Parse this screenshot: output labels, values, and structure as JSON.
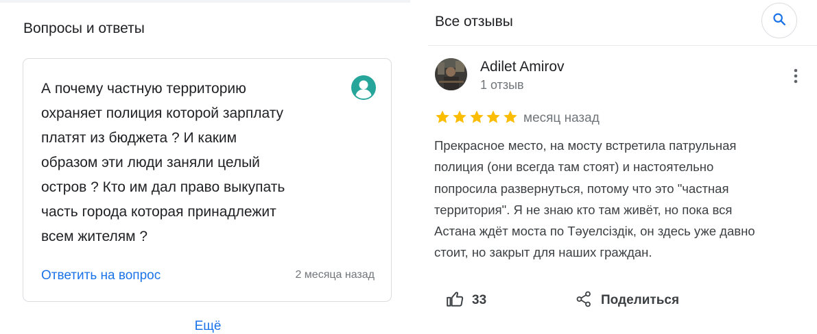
{
  "qa": {
    "title": "Вопросы и ответы",
    "question": "А почему частную территорию\nохраняет полиция которой зарплату\nплатят из бюджета ? И каким\nобразом эти люди заняли целый\nостров ? Кто им дал право выкупать\nчасть города которая принадлежит\nвсем жителям ?",
    "answer_link": "Ответить на вопрос",
    "time": "2 месяца назад",
    "more_link": "Ещё"
  },
  "reviews": {
    "title": "Все отзывы",
    "review": {
      "author": "Adilet Amirov",
      "author_meta": "1 отзыв",
      "rating": 5,
      "time": "месяц назад",
      "text": "Прекрасное место, на мосту встретила патрульная\nполиция (они всегда там стоят) и настоятельно\nпопросила развернуться, потому что это \"частная\nтерритория\". Я не знаю кто там живёт, но пока вся\nАстана ждёт моста по Тәуелсіздік, он здесь уже давно\nстоит, но закрыт для наших граждан.",
      "likes": "33",
      "share_label": "Поделиться"
    }
  },
  "icons": {
    "search": "search-icon",
    "user_avatar": "default-user-avatar-icon",
    "more": "more-vert-icon",
    "star": "star-icon",
    "like": "thumb-up-icon",
    "share": "share-icon"
  },
  "colors": {
    "link": "#1a73e8",
    "star": "#fbbc04",
    "avatar_bg": "#26a69a",
    "secondary_text": "#70757a"
  }
}
